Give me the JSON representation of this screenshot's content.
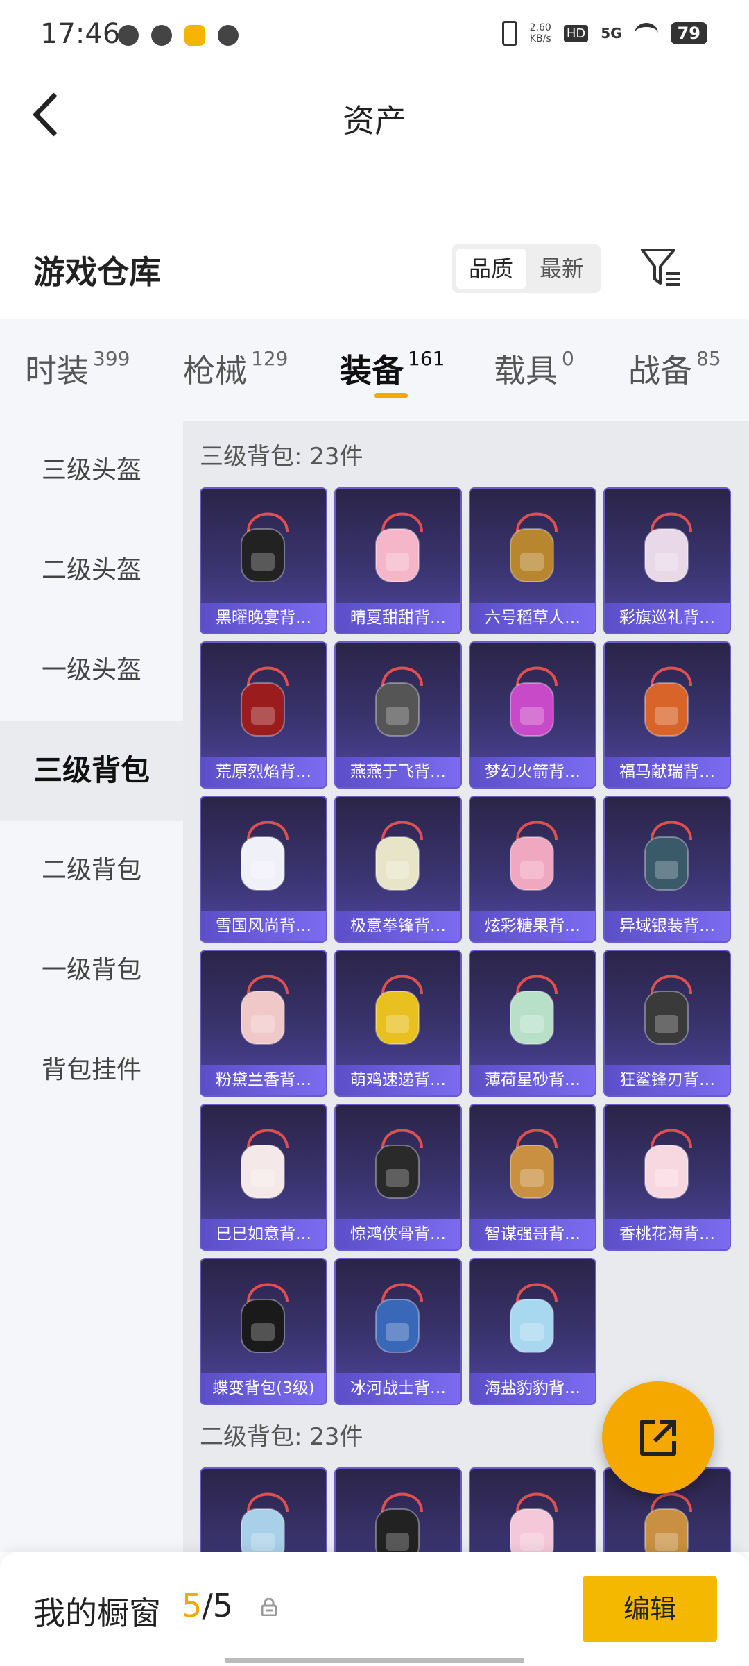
{
  "status_bar": {
    "time": "17:46",
    "net_speed_value": "2.60",
    "net_speed_unit": "KB/s",
    "hd": "HD",
    "signal": "5G",
    "battery": "79"
  },
  "header": {
    "title": "资产",
    "back_icon": "chevron-left-icon"
  },
  "warehouse": {
    "title": "游戏仓库",
    "sort_options": [
      "品质",
      "最新"
    ],
    "sort_selected": "品质",
    "filter_icon": "filter-icon"
  },
  "tabs": [
    {
      "label": "时装",
      "count": "399"
    },
    {
      "label": "枪械",
      "count": "129"
    },
    {
      "label": "装备",
      "count": "161"
    },
    {
      "label": "载具",
      "count": "0"
    },
    {
      "label": "战备",
      "count": "85"
    }
  ],
  "active_tab": "装备",
  "sidebar": [
    {
      "label": "三级头盔"
    },
    {
      "label": "二级头盔"
    },
    {
      "label": "一级头盔"
    },
    {
      "label": "三级背包"
    },
    {
      "label": "二级背包"
    },
    {
      "label": "一级背包"
    },
    {
      "label": "背包挂件"
    }
  ],
  "sidebar_active": "三级背包",
  "sections": [
    {
      "title": "三级背包: 23件",
      "items": [
        {
          "name": "黑曜晚宴背…",
          "color": "#222222"
        },
        {
          "name": "晴夏甜甜背…",
          "color": "#f4b6c8"
        },
        {
          "name": "六号稻草人…",
          "color": "#b8862e"
        },
        {
          "name": "彩旗巡礼背…",
          "color": "#e8d8e8"
        },
        {
          "name": "荒原烈焰背…",
          "color": "#9b1c1c"
        },
        {
          "name": "燕燕于飞背…",
          "color": "#555555"
        },
        {
          "name": "梦幻火箭背…",
          "color": "#c84ac8"
        },
        {
          "name": "福马献瑞背…",
          "color": "#d8642a"
        },
        {
          "name": "雪国风尚背…",
          "color": "#f0f0f8"
        },
        {
          "name": "极意拳锋背…",
          "color": "#e8e4c8"
        },
        {
          "name": "炫彩糖果背…",
          "color": "#f0a8c0"
        },
        {
          "name": "异域银装背…",
          "color": "#3a5a6a"
        },
        {
          "name": "粉黛兰香背…",
          "color": "#f0c8c8"
        },
        {
          "name": "萌鸡速递背…",
          "color": "#e8c020"
        },
        {
          "name": "薄荷星砂背…",
          "color": "#b8e0c8"
        },
        {
          "name": "狂鲨锋刃背…",
          "color": "#3a3a3a"
        },
        {
          "name": "巳巳如意背…",
          "color": "#f4e8e8"
        },
        {
          "name": "惊鸿侠骨背…",
          "color": "#2a2a2a"
        },
        {
          "name": "智谋强哥背…",
          "color": "#c89040"
        },
        {
          "name": "香桃花海背…",
          "color": "#f8d8e0"
        },
        {
          "name": "蝶变背包(3级)",
          "color": "#1a1a1a"
        },
        {
          "name": "冰河战士背…",
          "color": "#3a68b8"
        },
        {
          "name": "海盐豹豹背…",
          "color": "#a8d8f0"
        }
      ]
    },
    {
      "title": "二级背包: 23件",
      "items": [
        {
          "name": "",
          "color": "#a8d0e8"
        },
        {
          "name": "",
          "color": "#222222"
        },
        {
          "name": "",
          "color": "#f4c8d8"
        },
        {
          "name": "",
          "color": "#c89040"
        }
      ]
    }
  ],
  "fab": {
    "icon": "share-export-icon"
  },
  "bottom_bar": {
    "label": "我的橱窗",
    "current": "5",
    "total": "/5",
    "edit_label": "编辑"
  }
}
